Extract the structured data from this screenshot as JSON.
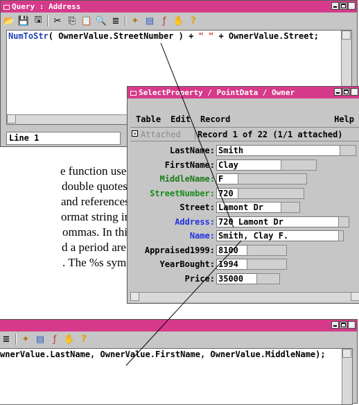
{
  "query_window": {
    "title": "Query : Address",
    "toolbar_icons": [
      "open-icon",
      "save-icon",
      "save-as-icon",
      "cut-icon",
      "copy-icon",
      "paste-icon",
      "find-icon",
      "insert-field-icon",
      "wizard-icon",
      "field-list-icon",
      "function-icon",
      "hand-icon",
      "help-icon"
    ],
    "code": {
      "func": "NumToStr",
      "after_func": "( OwnerValue.StreetNumber ) + ",
      "string": "\" \"",
      "tail": " + OwnerValue.Street;"
    },
    "status": "Line 1"
  },
  "property_window": {
    "title": "SelectProperty / PointData / Owner",
    "menu": [
      "Table",
      "Edit",
      "Record",
      "Help"
    ],
    "attached_label": "Attached",
    "record_label": "Record 1 of 22 (1/1 attached)",
    "fields": [
      {
        "name": "LastName:",
        "value": "Smith",
        "color": "#000000"
      },
      {
        "name": "FirstName:",
        "value": "Clay",
        "color": "#000000"
      },
      {
        "name": "MiddleName:",
        "value": "F",
        "color": "#1a7a1a"
      },
      {
        "name": "StreetNumber:",
        "value": "720",
        "color": "#1a8a1a"
      },
      {
        "name": "Street:",
        "value": "Lamont Dr",
        "color": "#000000"
      },
      {
        "name": "Address:",
        "value": "720 Lamont Dr",
        "color": "#2233dd"
      },
      {
        "name": "Name:",
        "value": "Smith, Clay F.",
        "color": "#2233dd"
      },
      {
        "name": "Appraised1999:",
        "value": "8100",
        "color": "#000000"
      },
      {
        "name": "YearBought:",
        "value": "1994",
        "color": "#000000"
      },
      {
        "name": "Price:",
        "value": "35000",
        "color": "#000000"
      }
    ]
  },
  "prose_lines": [
    "e function uses",
    "double quotes)",
    "and references",
    "ormat string in",
    "ommas. In this",
    "d a period are",
    ". The %s sym-"
  ],
  "second_query": {
    "code": "wnerValue.LastName, OwnerValue.FirstName, OwnerValue.MiddleName);"
  },
  "colors": {
    "titlebar": "#d63a8a",
    "window": "#c6c6c6"
  }
}
